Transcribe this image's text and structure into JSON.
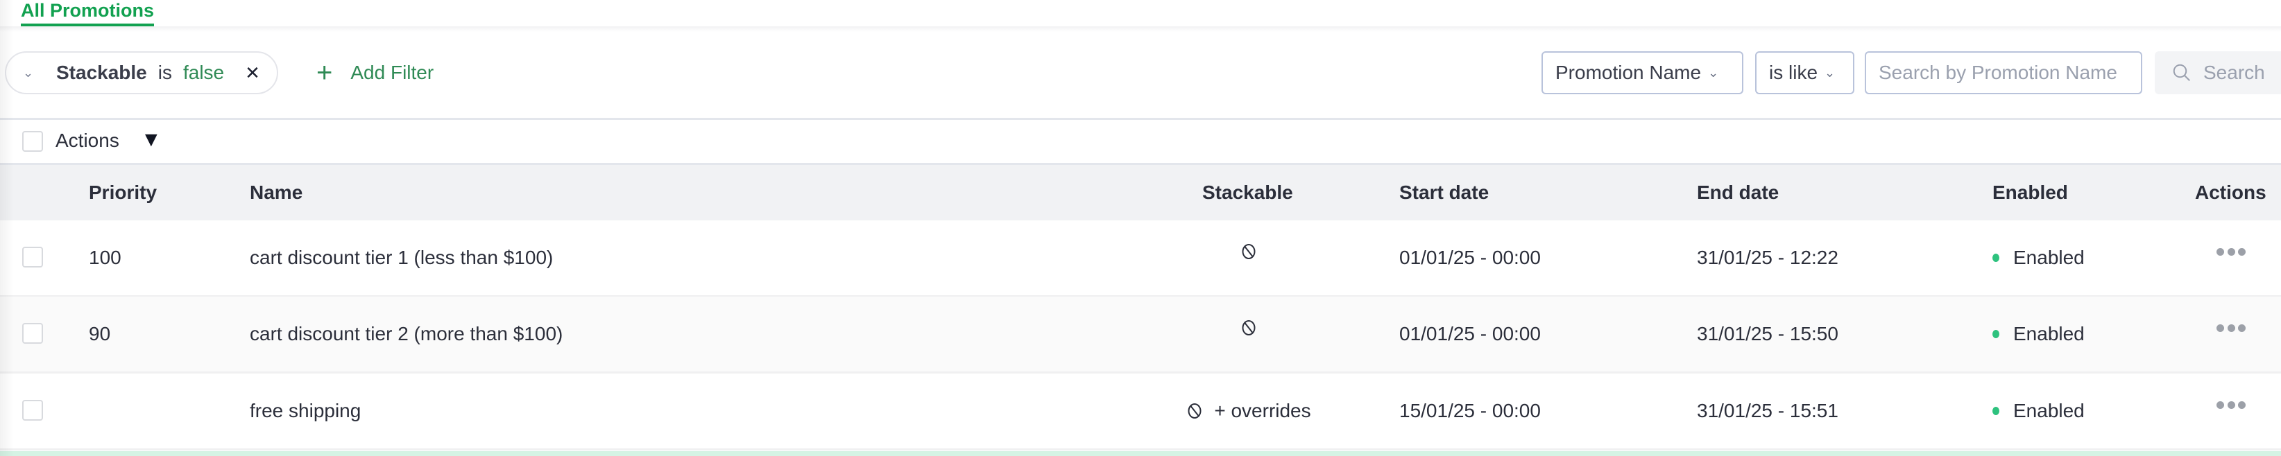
{
  "tabs": [
    {
      "label": "All Promotions",
      "active": true
    }
  ],
  "filters": {
    "active": [
      {
        "field": "Stackable",
        "operator": "is",
        "value": "false"
      }
    ],
    "add_filter_label": "Add Filter",
    "field_select": {
      "selected": "Promotion Name"
    },
    "operator_select": {
      "selected": "is like"
    },
    "search_input": {
      "value": "",
      "placeholder": "Search by Promotion Name"
    },
    "search_button_label": "Search"
  },
  "bulk_actions": {
    "label": "Actions"
  },
  "table": {
    "columns": [
      "Priority",
      "Name",
      "Stackable",
      "Start date",
      "End date",
      "Enabled",
      "Actions"
    ],
    "rows": [
      {
        "priority": "100",
        "name": "cart discount tier 1 (less than $100)",
        "stackable_icon": "ban-icon",
        "stackable_text": "",
        "start": "01/01/25 - 00:00",
        "end": "31/01/25 - 12:22",
        "enabled": "Enabled"
      },
      {
        "priority": "90",
        "name": "cart discount tier 2 (more than $100)",
        "stackable_icon": "ban-icon",
        "stackable_text": "",
        "start": "01/01/25 - 00:00",
        "end": "31/01/25 - 15:50",
        "enabled": "Enabled"
      },
      {
        "priority": "",
        "name": "free shipping",
        "stackable_icon": "ban-icon",
        "stackable_text": "+ overrides",
        "start": "15/01/25 - 00:00",
        "end": "31/01/25 - 15:51",
        "enabled": "Enabled"
      }
    ]
  },
  "colors": {
    "accent": "#12a150",
    "enabled_dot": "#2ec27e",
    "header_bg": "#f1f2f4"
  }
}
